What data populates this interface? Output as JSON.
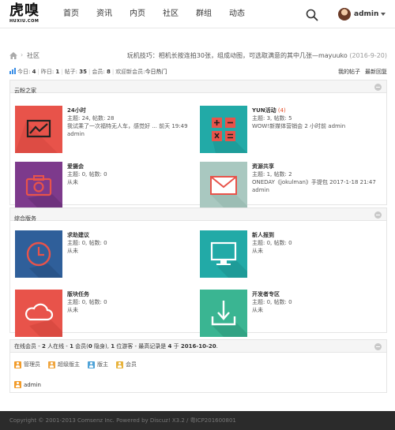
{
  "header": {
    "logo_main": "虎嗅",
    "logo_sub": "HUXIU.COM",
    "nav": [
      "首页",
      "资讯",
      "内页",
      "社区",
      "群组",
      "动态"
    ],
    "user_name": "admin"
  },
  "breadcrumb": {
    "separator": "›",
    "current": "社区",
    "tip_text": "玩机技巧：相机长按连拍30张，组成动图，可选取满意的其中几张—mayuuko",
    "tip_date": "(2016-9-20)"
  },
  "stats": {
    "today_label": "今日:",
    "today_value": "4",
    "yesterday_label": "昨日:",
    "yesterday_value": "1",
    "posts_label": "帖子:",
    "posts_value": "35",
    "members_label": "会员:",
    "members_value": "8",
    "welcome_label": "欢迎新会员:",
    "hot_label": "今日热门",
    "my_posts": "我的帖子",
    "latest_replies": "最新回复"
  },
  "categories": [
    {
      "title": "云粉之家",
      "forums": [
        {
          "name": "24小时",
          "new_count": "",
          "stats": "主题: 24, 帖数: 28",
          "last_post": "我试乘了一次福特无人车，感觉好 ... 前天 19:49",
          "last_user": "admin",
          "icon": "chart-icon",
          "color": "#e8534a"
        },
        {
          "name": "YUN活动",
          "new_count": "(4)",
          "stats": "主题: 3, 帖数: 5",
          "last_post": "WOW!新媒体营销会 2 小时前 admin",
          "last_user": "",
          "icon": "calculator-icon",
          "color": "#22aaa7"
        },
        {
          "name": "爱摄会",
          "new_count": "",
          "stats": "主题: 0, 帖数: 0",
          "last_post": "从未",
          "last_user": "",
          "icon": "camera-icon",
          "color": "#7d3a8c"
        },
        {
          "name": "资源共享",
          "new_count": "",
          "stats": "主题: 1, 帖数: 2",
          "last_post": "ONEDAY《jokulman》手提包 2017-1-18 21:47",
          "last_user": "admin",
          "icon": "mail-icon",
          "color": "#a9c8c0"
        }
      ]
    },
    {
      "title": "综合版务",
      "forums": [
        {
          "name": "求助建议",
          "new_count": "",
          "stats": "主题: 0, 帖数: 0",
          "last_post": "从未",
          "last_user": "",
          "icon": "clock-icon",
          "color": "#2f5f9a"
        },
        {
          "name": "新人报到",
          "new_count": "",
          "stats": "主题: 0, 帖数: 0",
          "last_post": "从未",
          "last_user": "",
          "icon": "monitor-icon",
          "color": "#22aaa7"
        },
        {
          "name": "版块任务",
          "new_count": "",
          "stats": "主题: 0, 帖数: 0",
          "last_post": "从未",
          "last_user": "",
          "icon": "cloud-icon",
          "color": "#e8534a"
        },
        {
          "name": "开发者专区",
          "new_count": "",
          "stats": "主题: 0, 帖数: 0",
          "last_post": "从未",
          "last_user": "",
          "icon": "download-icon",
          "color": "#3ab592"
        }
      ]
    }
  ],
  "online": {
    "p1": "在线会员 - ",
    "total": "2",
    "p2": " 人在线 - ",
    "members": "1",
    "p3": " 会员(",
    "hidden": "0",
    "p4": " 隐身), ",
    "guests": "1",
    "p5": " 位游客 - 最高记录是 ",
    "record": "4",
    "p6": " 于 ",
    "record_date": "2016-10-20",
    "p7": ".",
    "legend": [
      {
        "label": "管理员",
        "color": "#f29c2b"
      },
      {
        "label": "超级版主",
        "color": "#f0a640"
      },
      {
        "label": "版主",
        "color": "#4fa3d8"
      },
      {
        "label": "会员",
        "color": "#e8b33c"
      }
    ],
    "user": "admin"
  },
  "footer": {
    "text": "Copyright © 2001-2013 Comsenz Inc. Powered by Discuz! X3.2 / 粤ICP201600801"
  }
}
